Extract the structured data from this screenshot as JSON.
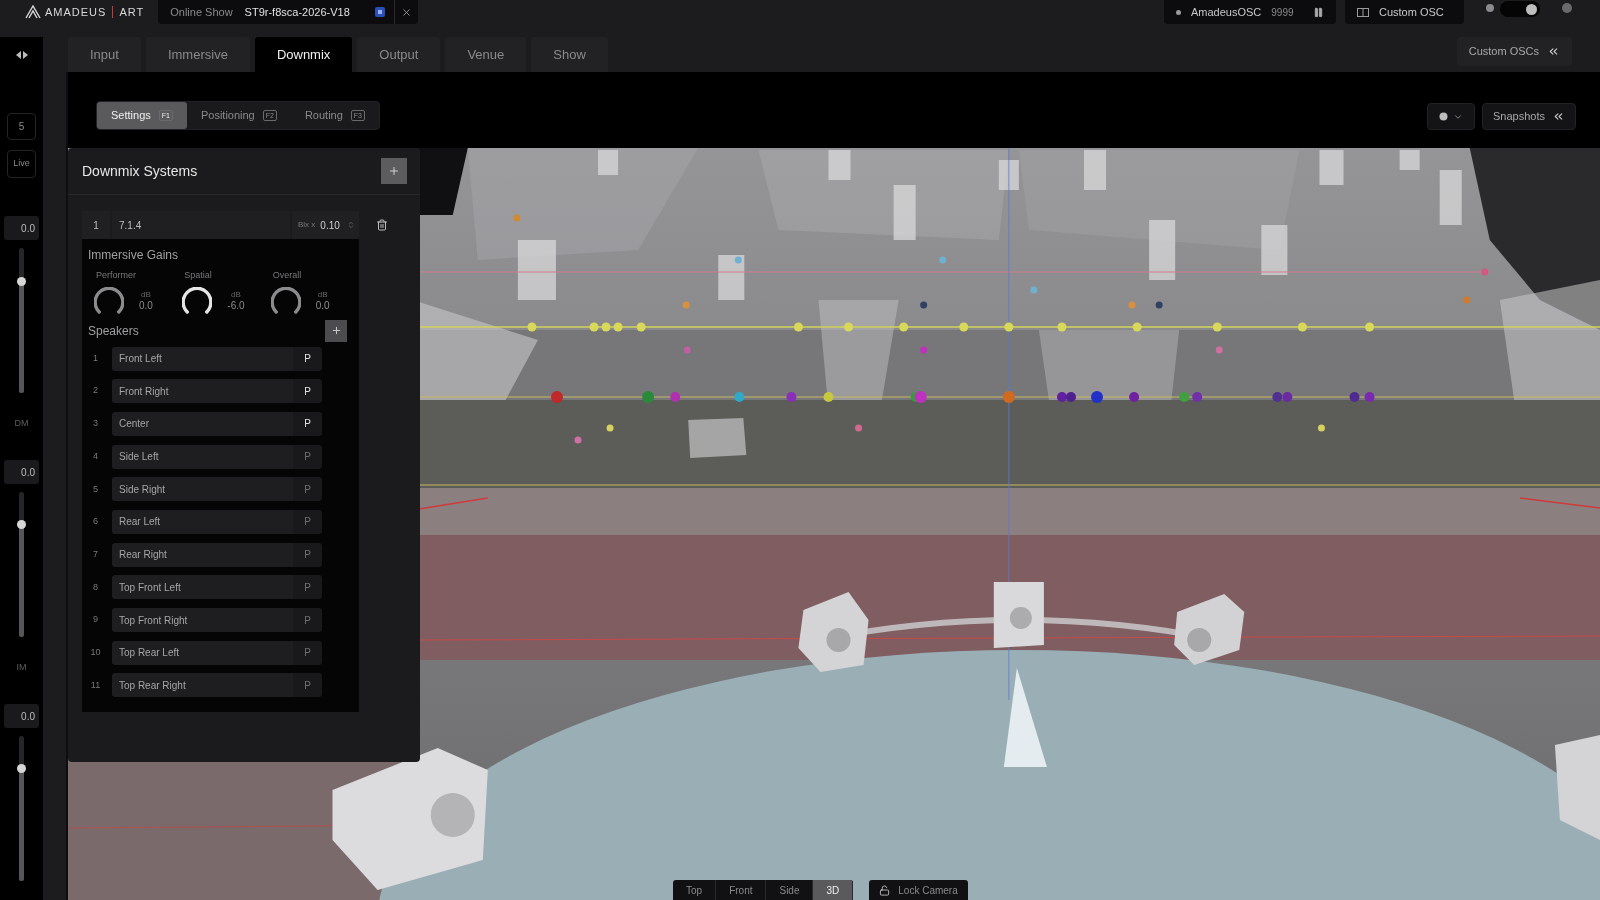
{
  "topbar": {
    "logo": {
      "name": "AMADEUS",
      "product": "ART"
    },
    "show_tab": {
      "label": "Online Show",
      "name": "ST9r-f8sca-2026-V18"
    },
    "osc_status": {
      "label": "AmadeusOSC",
      "port": "9999"
    },
    "custom_osc": {
      "label": "Custom OSC"
    },
    "toggle": {
      "on": true
    }
  },
  "nav_tabs": [
    {
      "label": "Input",
      "selected": false
    },
    {
      "label": "Immersive",
      "selected": false
    },
    {
      "label": "Downmix",
      "selected": true
    },
    {
      "label": "Output",
      "selected": false
    },
    {
      "label": "Venue",
      "selected": false
    },
    {
      "label": "Show",
      "selected": false
    }
  ],
  "custom_oscs_button": {
    "label": "Custom OSCs"
  },
  "sidebar": {
    "scene": "5",
    "mode": "Live",
    "faders": [
      {
        "value": "0.0",
        "level": 0.77
      },
      {
        "label": "DM",
        "value": "0.0",
        "level": 0.78
      },
      {
        "label": "IM",
        "value": "0.0",
        "level": 0.78
      }
    ]
  },
  "sub_tabs": [
    {
      "label": "Settings",
      "key": "F1",
      "selected": true
    },
    {
      "label": "Positioning",
      "key": "F2",
      "selected": false
    },
    {
      "label": "Routing",
      "key": "F3",
      "selected": false
    }
  ],
  "snapshots_button": {
    "label": "Snapshots"
  },
  "downmix_panel": {
    "title": "Downmix Systems",
    "system": {
      "index": "1",
      "name": "7.1.4",
      "bias_label": "Blx x",
      "bias_value": "0.10"
    },
    "gains_title": "Immersive Gains",
    "gains": [
      {
        "label": "Performer",
        "unit": "dB",
        "value": "0.0",
        "highlighted": false
      },
      {
        "label": "Spatial",
        "unit": "dB",
        "value": "-6.0",
        "highlighted": true
      },
      {
        "label": "Overall",
        "unit": "dB",
        "value": "0.0",
        "highlighted": false
      }
    ],
    "speakers_title": "Speakers",
    "speakers": [
      {
        "index": "1",
        "name": "Front Left",
        "p": "P",
        "active": true
      },
      {
        "index": "2",
        "name": "Front Right",
        "p": "P",
        "active": true
      },
      {
        "index": "3",
        "name": "Center",
        "p": "P",
        "active": true
      },
      {
        "index": "4",
        "name": "Side Left",
        "p": "P",
        "active": false
      },
      {
        "index": "5",
        "name": "Side Right",
        "p": "P",
        "active": false
      },
      {
        "index": "6",
        "name": "Rear Left",
        "p": "P",
        "active": false
      },
      {
        "index": "7",
        "name": "Rear Right",
        "p": "P",
        "active": false
      },
      {
        "index": "8",
        "name": "Top Front Left",
        "p": "P",
        "active": false
      },
      {
        "index": "9",
        "name": "Top Front Right",
        "p": "P",
        "active": false
      },
      {
        "index": "10",
        "name": "Top Rear Left",
        "p": "P",
        "active": false
      },
      {
        "index": "11",
        "name": "Top Rear Right",
        "p": "P",
        "active": false
      }
    ]
  },
  "view_buttons": [
    {
      "label": "Top",
      "selected": false
    },
    {
      "label": "Front",
      "selected": false
    },
    {
      "label": "Side",
      "selected": false
    },
    {
      "label": "3D",
      "selected": true
    }
  ],
  "lock_camera_button": {
    "label": "Lock Camera"
  }
}
